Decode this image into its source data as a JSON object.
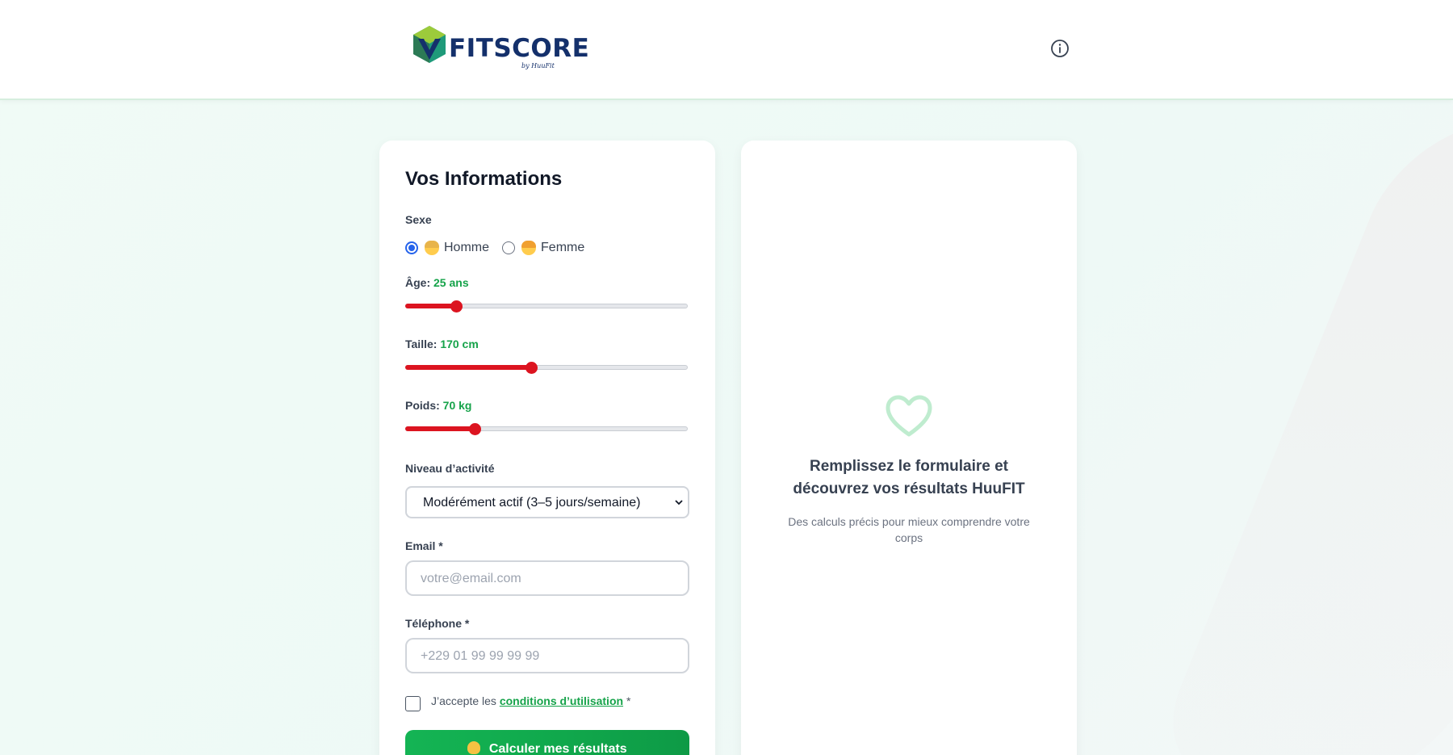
{
  "header": {
    "brand": "FITSCORE",
    "brand_sub": "by HuuFit",
    "info_icon": "info-icon"
  },
  "form": {
    "title": "Vos Informations",
    "sexe_label": "Sexe",
    "sexe_options": [
      {
        "label": "Homme",
        "icon": "man-emoji",
        "checked": true
      },
      {
        "label": "Femme",
        "icon": "woman-emoji",
        "checked": false
      }
    ],
    "age": {
      "label": "Âge:",
      "value": "25 ans",
      "fraction": 0.18
    },
    "taille": {
      "label": "Taille:",
      "value": "170 cm",
      "fraction": 0.445
    },
    "poids": {
      "label": "Poids:",
      "value": "70 kg",
      "fraction": 0.245
    },
    "activity": {
      "label": "Niveau d’activité",
      "selected": "Modérément actif (3–5 jours/semaine)"
    },
    "email": {
      "label": "Email *",
      "placeholder": "votre@email.com"
    },
    "phone": {
      "label": "Téléphone *",
      "placeholder": "+229 01 99 99 99 99"
    },
    "consent": {
      "prefix": "J’accepte les",
      "link": "conditions d’utilisation",
      "suffix": "*"
    },
    "submit_label": "Calculer mes résultats",
    "submit_icon": "flexed-biceps-emoji"
  },
  "results": {
    "icon": "heart-icon",
    "title": "Remplissez le formulaire et découvrez vos résultats HuuFIT",
    "subtitle": "Des calculs précis pour mieux comprendre votre corps"
  },
  "colors": {
    "accent_green": "#16a34a",
    "slider_red": "#dc1420",
    "brand_navy": "#14306b",
    "radio_blue": "#2563eb"
  }
}
